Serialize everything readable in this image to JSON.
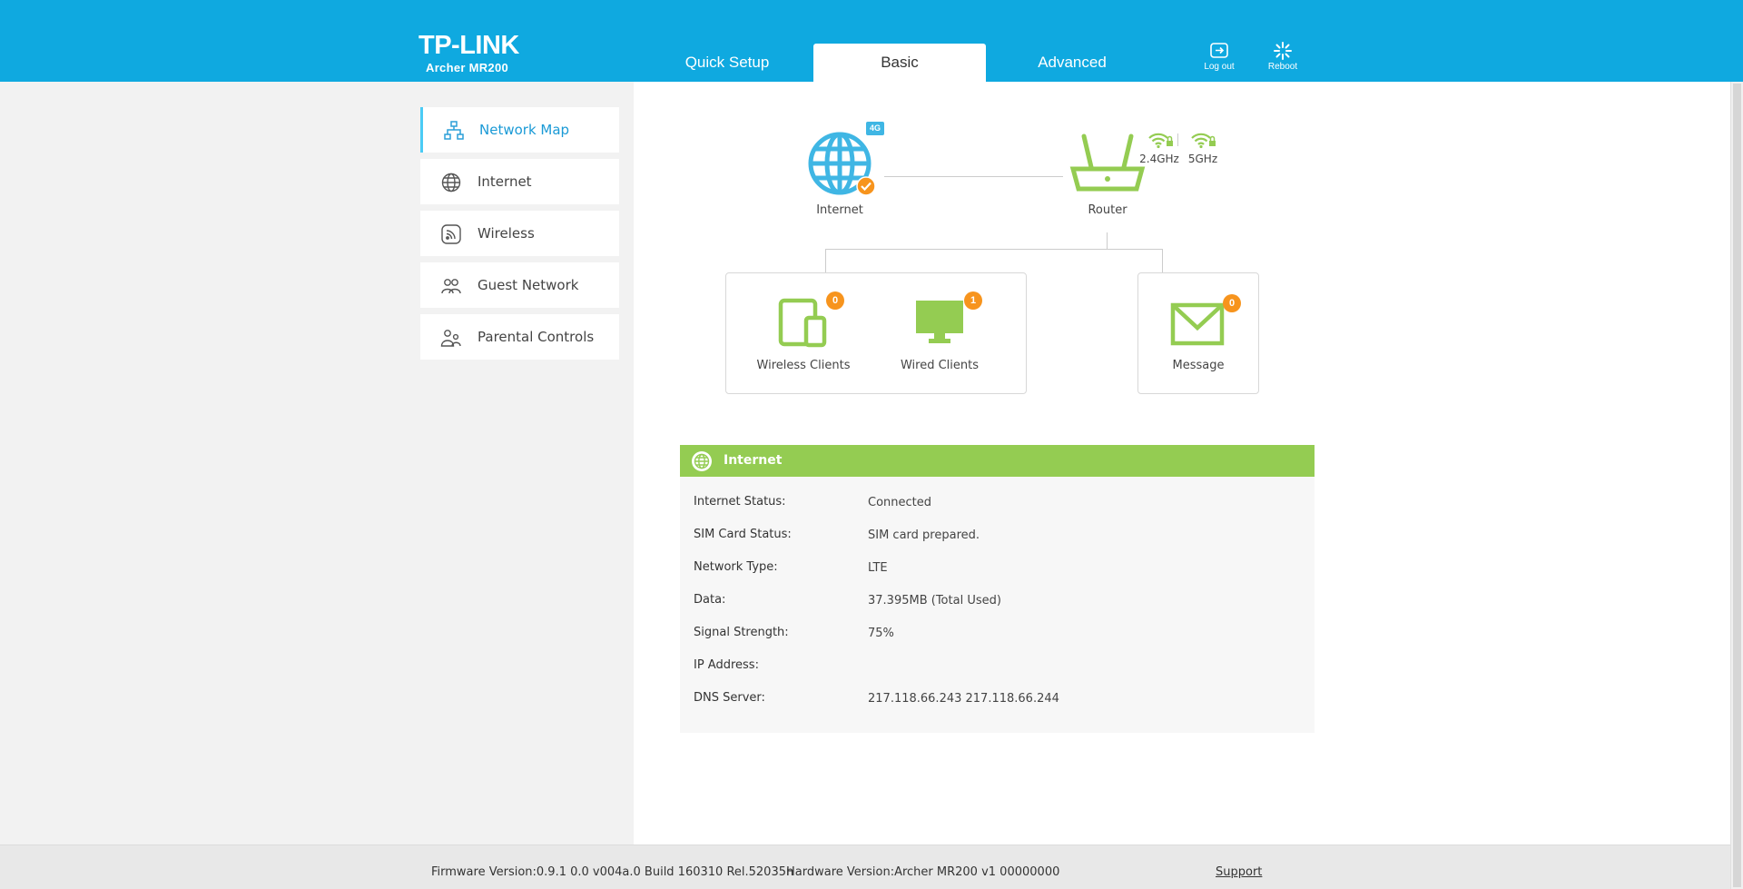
{
  "brand": {
    "name": "TP-LINK",
    "model": "Archer MR200"
  },
  "tabs": [
    {
      "label": "Quick Setup",
      "active": false
    },
    {
      "label": "Basic",
      "active": true
    },
    {
      "label": "Advanced",
      "active": false
    }
  ],
  "header_buttons": {
    "logout": "Log out",
    "reboot": "Reboot"
  },
  "sidebar": {
    "items": [
      {
        "label": "Network Map",
        "icon": "network-map-icon",
        "active": true
      },
      {
        "label": "Internet",
        "icon": "globe-icon",
        "active": false
      },
      {
        "label": "Wireless",
        "icon": "wireless-icon",
        "active": false
      },
      {
        "label": "Guest Network",
        "icon": "guest-icon",
        "active": false
      },
      {
        "label": "Parental Controls",
        "icon": "parental-icon",
        "active": false
      }
    ]
  },
  "network_map": {
    "internet": {
      "label": "Internet",
      "badge": "4G"
    },
    "router": {
      "label": "Router",
      "band_24": "2.4GHz",
      "band_5": "5GHz"
    },
    "wireless_clients": {
      "label": "Wireless Clients",
      "count": "0"
    },
    "wired_clients": {
      "label": "Wired Clients",
      "count": "1"
    },
    "message": {
      "label": "Message",
      "count": "0"
    }
  },
  "internet_panel": {
    "title": "Internet",
    "rows": [
      {
        "key": "Internet Status:",
        "value": "Connected"
      },
      {
        "key": "SIM Card Status:",
        "value": "SIM card prepared."
      },
      {
        "key": "Network Type:",
        "value": "LTE"
      },
      {
        "key": "Data:",
        "value": "37.395MB (Total Used)"
      },
      {
        "key": "Signal Strength:",
        "value": "75%"
      },
      {
        "key": "IP Address:",
        "value": ""
      },
      {
        "key": "DNS Server:",
        "value": "217.118.66.243 217.118.66.244"
      }
    ]
  },
  "footer": {
    "firmware": "Firmware Version:0.9.1 0.0 v004a.0 Build 160310 Rel.52035n",
    "hardware": "Hardware Version:Archer MR200 v1 00000000",
    "support": "Support"
  },
  "colors": {
    "header": "#0fa9e0",
    "accent_green": "#94cc52",
    "badge_orange": "#f7941d",
    "globe_blue": "#3fb6e4"
  }
}
